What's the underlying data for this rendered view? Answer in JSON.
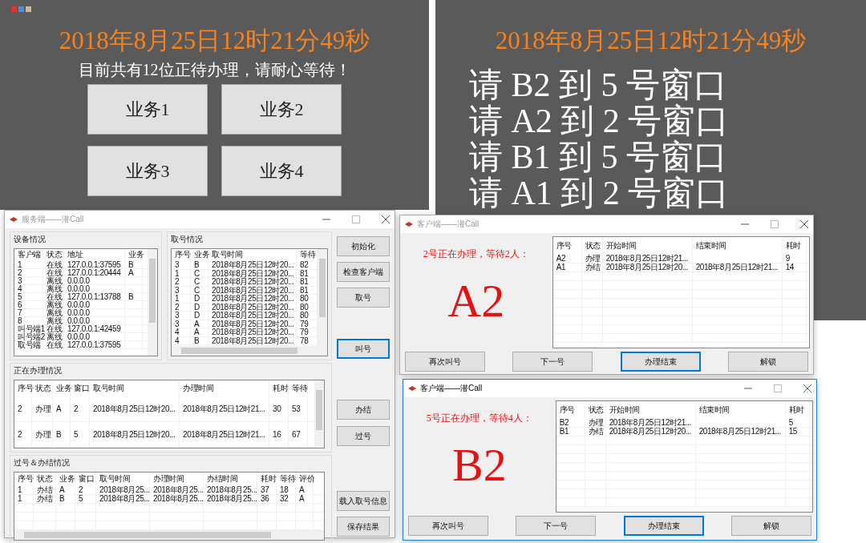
{
  "screen_a": {
    "time": "2018年8月25日12时21分49秒",
    "notice": "目前共有12位正待办理，请耐心等待！",
    "buttons": [
      "业务1",
      "业务2",
      "业务3",
      "业务4"
    ]
  },
  "screen_b": {
    "time": "2018年8月25日12时21分49秒",
    "calls": [
      "请 B2 到 5 号窗口",
      "请 A2 到 2 号窗口",
      "请 B1 到 5 号窗口",
      "请 A1 到 2 号窗口"
    ]
  },
  "server": {
    "title": "服务端——潜Call",
    "active": false,
    "devices": {
      "title": "设备情况",
      "columns": [
        "客户端",
        "状态",
        "地址",
        "业务"
      ],
      "rows": [
        [
          "1",
          "在线",
          "127.0.0.1:37595",
          "B"
        ],
        [
          "2",
          "在线",
          "127.0.0.1:20444",
          "A"
        ],
        [
          "3",
          "离线",
          "0.0.0.0",
          ""
        ],
        [
          "4",
          "离线",
          "0.0.0.0",
          ""
        ],
        [
          "5",
          "在线",
          "127.0.0.1:13788",
          "B"
        ],
        [
          "6",
          "离线",
          "0.0.0.0",
          ""
        ],
        [
          "7",
          "离线",
          "0.0.0.0",
          ""
        ],
        [
          "8",
          "离线",
          "0.0.0.0",
          ""
        ],
        [
          "叫号端1",
          "在线",
          "127.0.0.1:42459",
          ""
        ],
        [
          "叫号端2",
          "离线",
          "0.0.0.0",
          ""
        ],
        [
          "取号端",
          "在线",
          "127.0.0.1:37595",
          ""
        ]
      ]
    },
    "tickets": {
      "title": "取号情况",
      "columns": [
        "序号",
        "业务",
        "取号时间",
        "等待"
      ],
      "rows": [
        [
          "3",
          "B",
          "2018年8月25日12时20...",
          "82"
        ],
        [
          "1",
          "C",
          "2018年8月25日12时20...",
          "81"
        ],
        [
          "2",
          "C",
          "2018年8月25日12时20...",
          "81"
        ],
        [
          "3",
          "C",
          "2018年8月25日12时20...",
          "81"
        ],
        [
          "1",
          "D",
          "2018年8月25日12时20...",
          "80"
        ],
        [
          "2",
          "D",
          "2018年8月25日12时20...",
          "80"
        ],
        [
          "3",
          "D",
          "2018年8月25日12时20...",
          "80"
        ],
        [
          "3",
          "A",
          "2018年8月25日12时20...",
          "79"
        ],
        [
          "4",
          "A",
          "2018年8月25日12时20...",
          "79"
        ],
        [
          "4",
          "B",
          "2018年8月25日12时20...",
          "78"
        ]
      ]
    },
    "processing": {
      "title": "正在办理情况",
      "columns": [
        "序号",
        "状态",
        "业务",
        "窗口",
        "取号时间",
        "办理时间",
        "耗时",
        "等待"
      ],
      "rows": [
        [
          "2",
          "办理",
          "A",
          "2",
          "2018年8月25日12时20...",
          "2018年8月25日12时21...",
          "30",
          "53"
        ],
        [
          "2",
          "办理",
          "B",
          "5",
          "2018年8月25日12时20...",
          "2018年8月25日12时21...",
          "16",
          "67"
        ]
      ]
    },
    "finished": {
      "title": "过号＆办结情况",
      "columns": [
        "序号",
        "状态",
        "业务",
        "窗口",
        "取号时间",
        "办理时间",
        "办结时间",
        "耗时",
        "等待",
        "评价"
      ],
      "rows": [
        [
          "1",
          "办结",
          "A",
          "2",
          "2018年8月25...",
          "2018年8月25...",
          "2018年8月25...",
          "37",
          "18",
          "A"
        ],
        [
          "1",
          "办结",
          "B",
          "5",
          "2018年8月25...",
          "2018年8月25...",
          "2018年8月25...",
          "36",
          "32",
          "A"
        ]
      ]
    },
    "buttons": [
      {
        "label": "初始化",
        "focused": false
      },
      {
        "label": "检查客户端",
        "focused": false
      },
      {
        "label": "取号",
        "focused": false
      },
      {
        "label": "叫号",
        "focused": true
      },
      {
        "label": "办结",
        "focused": false
      },
      {
        "label": "过号",
        "focused": false
      },
      {
        "label": "载入取号信息",
        "focused": false
      },
      {
        "label": "保存结果",
        "focused": false
      }
    ]
  },
  "clients": [
    {
      "title": "客户端——潜Call",
      "active": false,
      "status": "2号正在办理，等待2人：",
      "current": "A2",
      "columns": [
        "序号",
        "状态",
        "开始时间",
        "结束时间",
        "耗时"
      ],
      "rows": [
        [
          "A2",
          "办理",
          "2018年8月25日12时21...",
          "",
          "9"
        ],
        [
          "A1",
          "办结",
          "2018年8月25日12时20...",
          "2018年8月25日12时21...",
          "14"
        ]
      ],
      "buttons": [
        {
          "label": "再次叫号",
          "focused": false
        },
        {
          "label": "下一号",
          "focused": false
        },
        {
          "label": "办理结束",
          "focused": true
        },
        {
          "label": "解锁",
          "focused": false
        }
      ]
    },
    {
      "title": "客户端——潜Call",
      "active": true,
      "status": "5号正在办理，等待4人：",
      "current": "B2",
      "columns": [
        "序号",
        "状态",
        "开始时间",
        "结束时间",
        "耗时"
      ],
      "rows": [
        [
          "B2",
          "办理",
          "2018年8月25日12时21...",
          "",
          "5"
        ],
        [
          "B1",
          "办结",
          "2018年8月25日12时20...",
          "2018年8月25日12时21...",
          "15"
        ]
      ],
      "buttons": [
        {
          "label": "再次叫号",
          "focused": false
        },
        {
          "label": "下一号",
          "focused": false
        },
        {
          "label": "办理结束",
          "focused": true
        },
        {
          "label": "解锁",
          "focused": false
        }
      ]
    }
  ]
}
